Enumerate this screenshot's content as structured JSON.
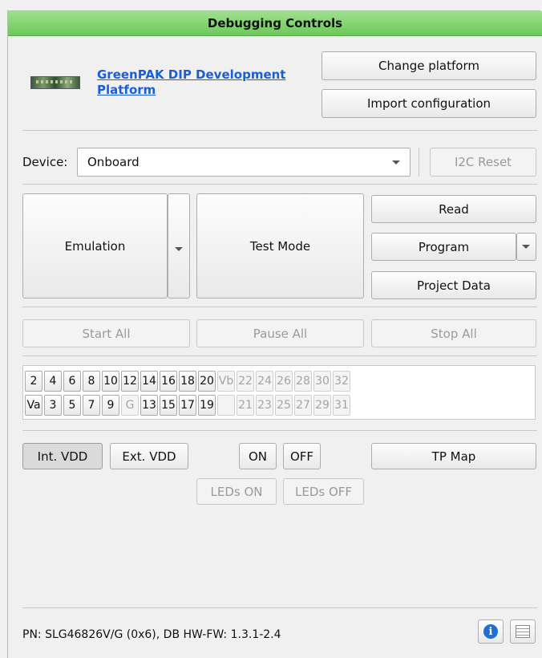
{
  "header": {
    "title": "Debugging Controls"
  },
  "platform": {
    "name": "GreenPAK DIP Development Platform",
    "change_label": "Change platform",
    "import_label": "Import configuration"
  },
  "device": {
    "label": "Device:",
    "value": "Onboard",
    "reset_label": "I2C Reset"
  },
  "modes": {
    "emulation": "Emulation",
    "test_mode": "Test Mode",
    "read": "Read",
    "program": "Program",
    "project_data": "Project Data"
  },
  "control": {
    "start_all": "Start All",
    "pause_all": "Pause All",
    "stop_all": "Stop All"
  },
  "pins": {
    "row1": [
      "2",
      "4",
      "6",
      "8",
      "10",
      "12",
      "14",
      "16",
      "18",
      "20",
      "Vb",
      "22",
      "24",
      "26",
      "28",
      "30",
      "32"
    ],
    "row2": [
      "Va",
      "3",
      "5",
      "7",
      "9",
      "G",
      "13",
      "15",
      "17",
      "19",
      "",
      "21",
      "23",
      "25",
      "27",
      "29",
      "31"
    ]
  },
  "power": {
    "int_vdd": "Int. VDD",
    "ext_vdd": "Ext. VDD",
    "on": "ON",
    "off": "OFF",
    "tp_map": "TP Map",
    "leds_on": "LEDs ON",
    "leds_off": "LEDs OFF"
  },
  "footer": {
    "status": "PN: SLG46826V/G (0x6), DB HW-FW: 1.3.1-2.4"
  },
  "icons": {
    "board": "board-image",
    "info": "info-icon",
    "log": "list-icon"
  },
  "colors": {
    "header": "#6cc95a",
    "link": "#1a5fd6",
    "info": "#1f6fd6"
  }
}
